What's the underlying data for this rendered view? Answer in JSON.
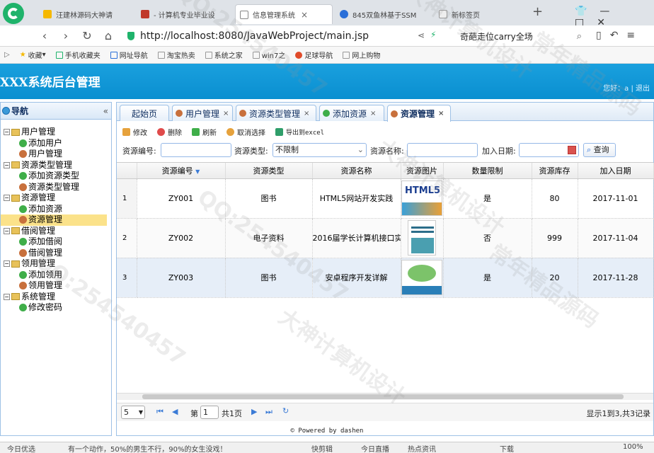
{
  "browser": {
    "tabs": [
      {
        "label": "汪建林源码大神请",
        "icon_color": "#f5b800"
      },
      {
        "label": "- 计算机专业毕业设",
        "icon_color": "#c0392b"
      },
      {
        "label": "信息管理系统",
        "icon_color": "#888888"
      },
      {
        "label": "845双鱼林基于SSM",
        "icon_color": "#2a6fd8"
      },
      {
        "label": "新标签页",
        "icon_color": "#999999"
      }
    ],
    "new_tab": "+",
    "url": "http://localhost:8080/JavaWebProject/main.jsp",
    "search_text": "奇葩走位carry全场",
    "favorites": [
      "收藏",
      "手机收藏夹",
      "网址导航",
      "淘宝热卖",
      "系统之家",
      "win7之",
      "足球导航",
      "网上购物"
    ]
  },
  "app": {
    "title": "XXX系统后台管理",
    "greeting": "您好：a",
    "separator": "|",
    "logout": "退出"
  },
  "sidebar": {
    "title": "导航",
    "collapse": "«",
    "groups": [
      {
        "label": "用户管理",
        "items": [
          "添加用户",
          "用户管理"
        ]
      },
      {
        "label": "资源类型管理",
        "items": [
          "添加资源类型",
          "资源类型管理"
        ]
      },
      {
        "label": "资源管理",
        "items": [
          "添加资源",
          "资源管理"
        ]
      },
      {
        "label": "借阅管理",
        "items": [
          "添加借阅",
          "借阅管理"
        ]
      },
      {
        "label": "领用管理",
        "items": [
          "添加领用",
          "领用管理"
        ]
      },
      {
        "label": "系统管理",
        "items": [
          "修改密码"
        ]
      }
    ],
    "selected": "资源管理"
  },
  "page_tabs": [
    {
      "label": "起始页"
    },
    {
      "label": "用户管理"
    },
    {
      "label": "资源类型管理"
    },
    {
      "label": "添加资源"
    },
    {
      "label": "资源管理"
    }
  ],
  "toolbar": {
    "edit": "修改",
    "delete": "删除",
    "refresh": "刷新",
    "unselect": "取消选择",
    "export": "导出到excel"
  },
  "filters": {
    "code_label": "资源编号:",
    "type_label": "资源类型:",
    "type_value": "不限制",
    "name_label": "资源名称:",
    "date_label": "加入日期:",
    "query": "查询"
  },
  "table": {
    "headers": [
      "资源编号",
      "资源类型",
      "资源名称",
      "资源图片",
      "数量限制",
      "资源库存",
      "加入日期"
    ],
    "rows": [
      {
        "n": "1",
        "code": "ZY001",
        "type": "图书",
        "name": "HTML5网站开发实践",
        "limit": "是",
        "stock": "80",
        "date": "2017-11-01"
      },
      {
        "n": "2",
        "code": "ZY002",
        "type": "电子资料",
        "name": "2016届学长计算机接口实",
        "limit": "否",
        "stock": "999",
        "date": "2017-11-04"
      },
      {
        "n": "3",
        "code": "ZY003",
        "type": "图书",
        "name": "安卓程序开发详解",
        "limit": "是",
        "stock": "20",
        "date": "2017-11-28"
      }
    ]
  },
  "pager": {
    "size": "5",
    "page_label": "第",
    "page": "1",
    "total": "共1页",
    "summary": "显示1到3,共3记录"
  },
  "footer": "© Powered by dashen",
  "statusbar": {
    "left": "今日优选",
    "ticker": "有一个动作，50%的男生不行，90%的女生没戏！",
    "items": [
      "快剪辑",
      "今日直播",
      "热点资讯"
    ],
    "download": "下载",
    "zoom": "100%"
  },
  "watermarks": [
    "QQ:254540457",
    "大神计算机设计",
    "常年精品源码",
    "QQ:254540457",
    "大神计算机设计",
    "常年精品源码",
    "QQ:254540457",
    "大神计算机设计"
  ]
}
